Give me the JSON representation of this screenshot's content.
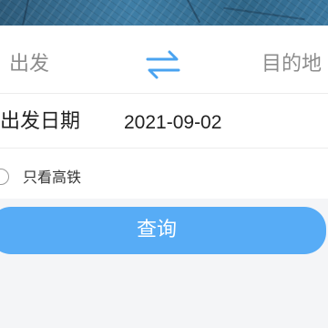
{
  "search": {
    "from_placeholder": "出发",
    "to_placeholder": "目的地",
    "date_label": "出发日期",
    "date_value": "2021-09-02",
    "high_speed_only_label": "只看高铁",
    "query_button": "查询"
  },
  "colors": {
    "accent": "#57acf6",
    "swap_icon": "#4aa3f0",
    "placeholder_text": "#8c8c8c"
  },
  "icons": {
    "swap": "swap-arrows-icon",
    "radio": "radio-unchecked-icon"
  }
}
